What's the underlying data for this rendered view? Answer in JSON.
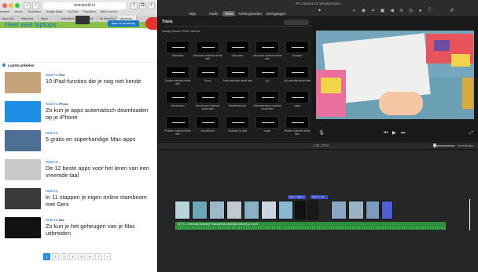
{
  "safari": {
    "url": "macworld.nl",
    "bookmarks": [
      "Intranet",
      "Yahoo!",
      "Quikstaine",
      "Google Maps",
      "YouTube",
      "Populair ▾",
      "Add in server"
    ],
    "tabs": [
      "Inbox (21)",
      "Macworld",
      "Kaart",
      "Gebruikers",
      "▸ Page Ad",
      "50 Reel Kvn",
      "MacWorld ..."
    ],
    "ad": {
      "title": "Heel veel laptops.",
      "button": "Naar de keuzehulp"
    },
    "latest_header": "Laatste artikelen",
    "articles": [
      {
        "category": "HOW TO",
        "subcat": "iPad",
        "title": "10 iPad-functies die je nog niet kende",
        "color": "#c4a27a"
      },
      {
        "category": "HOW TO",
        "subcat": "iPhone",
        "title": "Zo kun je apps automatisch downloaden op je iPhone",
        "color": "#1d8fe5"
      },
      {
        "category": "HOW TO",
        "subcat": "",
        "title": "5 gratis en superhandige Mac-apps",
        "color": "#4c6f93"
      },
      {
        "category": "HOW TO",
        "subcat": "",
        "title": "De 12 beste apps voor het leren van een vreemde taal",
        "color": "#c9c9c9"
      },
      {
        "category": "HOW TO",
        "subcat": "",
        "title": "In 11 stappen je eigen online stamboom met Geni",
        "color": "#3a3a3a"
      },
      {
        "category": "HOW TO",
        "subcat": "Mac",
        "title": "Zo kun je het geheugen van je Mac uitbreiden",
        "color": "#111111"
      }
    ],
    "pages": [
      "1",
      "2",
      "3",
      "4",
      "5",
      "6",
      "7",
      "»"
    ]
  },
  "imovie": {
    "window_title": "IPS Slotnies #2 achtergronden",
    "tabs": [
      "Mijn media",
      "Audio",
      "Titels",
      "Achtergronden",
      "Overgangen"
    ],
    "active_tab": "Titels",
    "browser_title": "Titels",
    "browser_subtitle": "Huidig thema: Geen thema",
    "title_tiles": [
      "Standaard",
      "Standaard onderste derde deel",
      "Uitvouwen",
      "Uitvouwen onderste derde deel",
      "Vervagen",
      "Tonnen onderste derde deel",
      "Focus",
      "Focus onderste derde deel",
      "Lijn",
      "Lijn onderste derde deel",
      "Verschuiven",
      "Verschuiven onderste derde deel",
      "Zweefdelenstuk",
      "Zweefdelenstuk onderste derde deel",
      "Lagen",
      "Pixelise onderste derde deel",
      "Gecentreerd",
      "Onderste 3e deel",
      "Lagen",
      "Pixelen onderste derde deel"
    ],
    "timecode": "1:28 / 8:54",
    "settings_label": "Instellingen",
    "audio_label": "16,7 s – Onderste(Geoluwe)(Trekaus)#2#&onderstepumbrecht_p.1.mp3",
    "clip_labels": [
      "2,8 s – Kenn...",
      "13,7 s – So..."
    ],
    "clip_colors": [
      "#b9d3da",
      "#6aa7b9",
      "#9db8c6",
      "#c0c9cf",
      "#89b0c4",
      "#c9d6df",
      "#88b9d0",
      "#111111",
      "#1a1a1a",
      "#8aa6c2",
      "#9cb3c4",
      "#7c9cbf",
      "#4f5fd4"
    ]
  }
}
